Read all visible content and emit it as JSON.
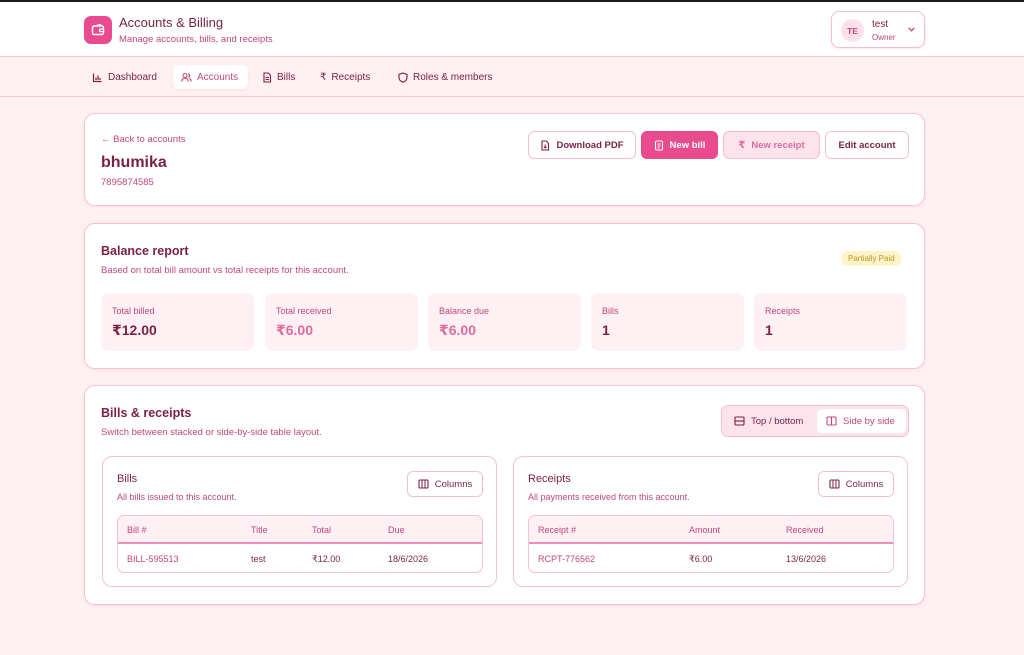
{
  "app": {
    "title": "Accounts & Billing",
    "subtitle": "Manage accounts, bills, and receipts"
  },
  "user": {
    "initials": "TE",
    "name": "test",
    "role": "Owner"
  },
  "nav": {
    "items": [
      {
        "label": "Dashboard",
        "icon": "bar-chart-icon"
      },
      {
        "label": "Accounts",
        "icon": "users-icon",
        "active": true
      },
      {
        "label": "Bills",
        "icon": "file-icon"
      },
      {
        "label": "Receipts",
        "icon": "rupee-icon"
      },
      {
        "label": "Roles & members",
        "icon": "shield-icon"
      }
    ]
  },
  "account": {
    "back_label": "← Back to accounts",
    "name": "bhumika",
    "phone": "7895874585",
    "actions": {
      "download_pdf": "Download PDF",
      "new_bill": "New bill",
      "new_receipt": "New receipt",
      "edit_account": "Edit account"
    }
  },
  "balance": {
    "title": "Balance report",
    "subtitle": "Based on total bill amount vs total receipts for this account.",
    "status": "Partially Paid",
    "stats": [
      {
        "label": "Total billed",
        "value": "₹12.00"
      },
      {
        "label": "Total received",
        "value": "₹6.00"
      },
      {
        "label": "Balance due",
        "value": "₹6.00"
      },
      {
        "label": "Bills",
        "value": "1"
      },
      {
        "label": "Receipts",
        "value": "1"
      }
    ]
  },
  "bills_receipts": {
    "title": "Bills & receipts",
    "subtitle": "Switch between stacked or side-by-side table layout.",
    "layout_options": {
      "top_bottom": "Top / bottom",
      "side_by_side": "Side by side"
    },
    "columns_label": "Columns",
    "bills": {
      "title": "Bills",
      "description": "All bills issued to this account.",
      "headers": [
        "Bill #",
        "Title",
        "Total",
        "Due"
      ],
      "rows": [
        [
          "BILL-595513",
          "test",
          "₹12.00",
          "18/6/2026"
        ]
      ]
    },
    "receipts": {
      "title": "Receipts",
      "description": "All payments received from this account.",
      "headers": [
        "Receipt #",
        "Amount",
        "Received"
      ],
      "rows": [
        [
          "RCPT-776562",
          "₹6.00",
          "13/6/2026"
        ]
      ]
    }
  },
  "colors": {
    "accent": "#e94b8e",
    "text_primary": "#7a1f46",
    "text_secondary": "#c2477d",
    "page_bg": "#fff0f1",
    "badge_bg": "#fff3c9",
    "badge_text": "#c79520"
  }
}
